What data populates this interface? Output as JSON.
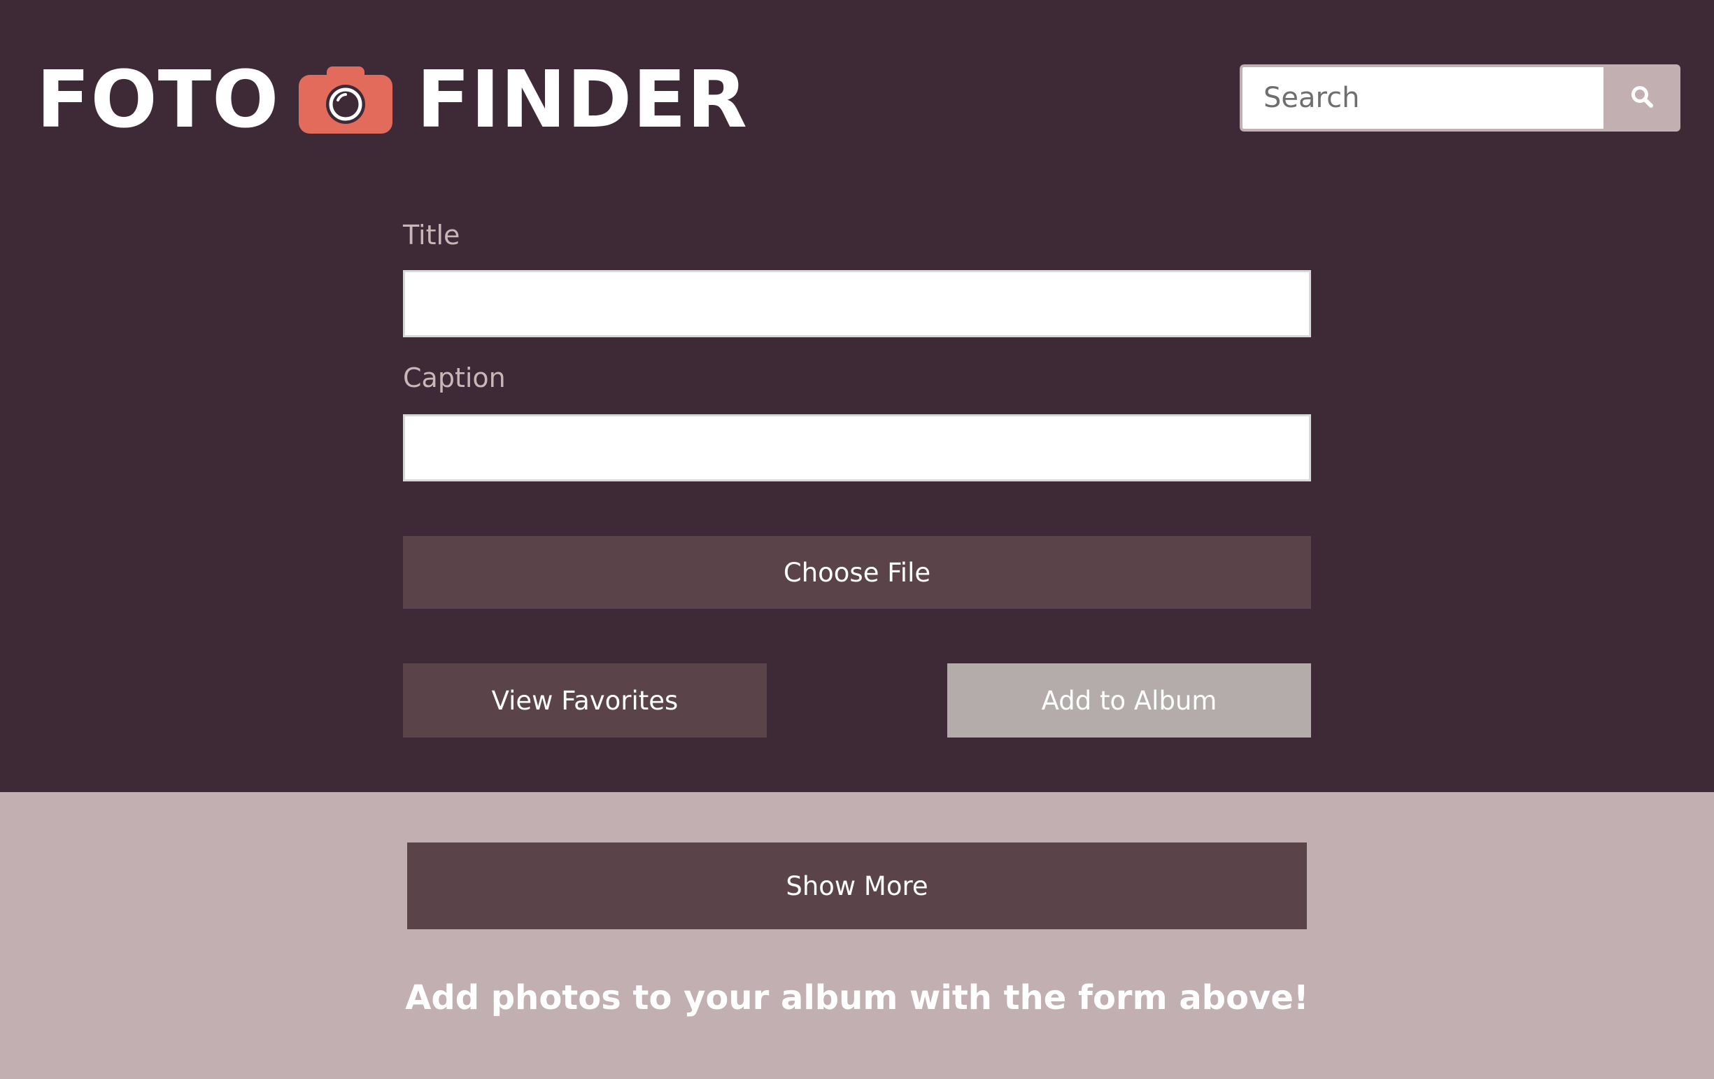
{
  "header": {
    "logo_left": "FOTO",
    "logo_right": "FINDER",
    "logo_icon": "camera-icon",
    "search": {
      "placeholder": "Search",
      "value": "",
      "icon": "search-icon"
    }
  },
  "form": {
    "title_label": "Title",
    "title_value": "",
    "caption_label": "Caption",
    "caption_value": "",
    "choose_file_label": "Choose File",
    "view_favorites_label": "View Favorites",
    "add_to_album_label": "Add to Album"
  },
  "album": {
    "show_more_label": "Show More",
    "empty_message": "Add photos to your album with the form above!"
  },
  "colors": {
    "header_bg": "#3e2a36",
    "content_bg": "#c1afb1",
    "button_dark": "#5b4449",
    "button_disabled": "#b3acab",
    "camera_accent": "#e26b5c",
    "label_text": "#c9b6b8"
  }
}
